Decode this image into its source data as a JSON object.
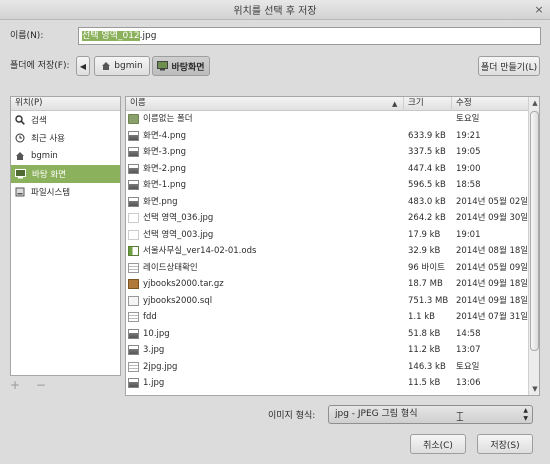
{
  "window": {
    "title": "위치를 선택 후 저장",
    "close_glyph": "×"
  },
  "name_row": {
    "label": "이름(N):",
    "value_selected": "선택 영역_012",
    "value_rest": ".jpg"
  },
  "folder_row": {
    "label": "폴더에 저장(F):",
    "back_arrow": "◀",
    "crumbs": [
      "bgmin",
      "바탕화면"
    ],
    "mkdir_label": "폴더 만들기(L)"
  },
  "places": {
    "header": "위치(P)",
    "items": [
      {
        "label": "검색",
        "icon": "search-icon"
      },
      {
        "label": "최근 사용",
        "icon": "clock-icon"
      },
      {
        "label": "bgmin",
        "icon": "home-icon"
      },
      {
        "label": "바탕 화면",
        "icon": "desktop-icon",
        "active": true
      },
      {
        "label": "파일시스템",
        "icon": "drive-icon"
      }
    ],
    "footer": "+ −"
  },
  "files": {
    "columns": {
      "name": "이름",
      "size": "크기",
      "modified": "수정"
    },
    "sort_glyph": "▲",
    "rows": [
      {
        "name": "이름없는 폴더",
        "size": "",
        "modified": "토요일",
        "icon": "folder"
      },
      {
        "name": "화면-4.png",
        "size": "633.9 kB",
        "modified": "19:21",
        "icon": "image"
      },
      {
        "name": "화면-3.png",
        "size": "337.5 kB",
        "modified": "19:05",
        "icon": "image"
      },
      {
        "name": "화면-2.png",
        "size": "447.4 kB",
        "modified": "19:00",
        "icon": "image"
      },
      {
        "name": "화면-1.png",
        "size": "596.5 kB",
        "modified": "18:58",
        "icon": "image"
      },
      {
        "name": "화면.png",
        "size": "483.0 kB",
        "modified": "2014년 05월 02일",
        "icon": "image"
      },
      {
        "name": "선택 영역_036.jpg",
        "size": "264.2 kB",
        "modified": "2014년 09월 30일",
        "icon": "image-blank"
      },
      {
        "name": "선택 영역_003.jpg",
        "size": "17.9 kB",
        "modified": "19:01",
        "icon": "image-blank"
      },
      {
        "name": "서울사무실_ver14-02-01.ods",
        "size": "32.9 kB",
        "modified": "2014년 08월 18일",
        "icon": "ods"
      },
      {
        "name": "레이드상태확인",
        "size": "96 바이트",
        "modified": "2014년 05월 09일",
        "icon": "doc"
      },
      {
        "name": "yjbooks2000.tar.gz",
        "size": "18.7 MB",
        "modified": "2014년 09월 18일",
        "icon": "archive"
      },
      {
        "name": "yjbooks2000.sql",
        "size": "751.3 MB",
        "modified": "2014년 09월 18일",
        "icon": "sql"
      },
      {
        "name": "fdd",
        "size": "1.1 kB",
        "modified": "2014년 07월 31일",
        "icon": "doc"
      },
      {
        "name": "10.jpg",
        "size": "51.8 kB",
        "modified": "14:58",
        "icon": "image"
      },
      {
        "name": "3.jpg",
        "size": "11.2 kB",
        "modified": "13:07",
        "icon": "image"
      },
      {
        "name": "2jpg.jpg",
        "size": "146.3 kB",
        "modified": "토요일",
        "icon": "doc"
      },
      {
        "name": "1.jpg",
        "size": "11.5 kB",
        "modified": "13:06",
        "icon": "image"
      }
    ]
  },
  "file_type": {
    "label": "이미지 형식:",
    "value": "jpg - JPEG 그림 형식",
    "arrows": "▲▼"
  },
  "buttons": {
    "cancel": "취소(C)",
    "save": "저장(S)"
  }
}
